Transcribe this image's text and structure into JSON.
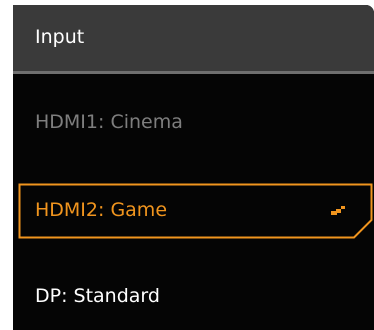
{
  "panel": {
    "title": "Input"
  },
  "menu": {
    "items": [
      {
        "label": "HDMI1: Cinema",
        "state": "disabled"
      },
      {
        "label": "HDMI2: Game",
        "state": "selected"
      },
      {
        "label": "DP: Standard",
        "state": "normal"
      }
    ]
  },
  "colors": {
    "panel_background": "#050505",
    "header_background": "#3a3a3a",
    "header_divider": "#6f6f6f",
    "accent": "#f1951e",
    "disabled_text": "#7e7e7e",
    "normal_text": "#ffffff"
  },
  "icons": {
    "selected_item_icon": "resize-handle-icon"
  }
}
